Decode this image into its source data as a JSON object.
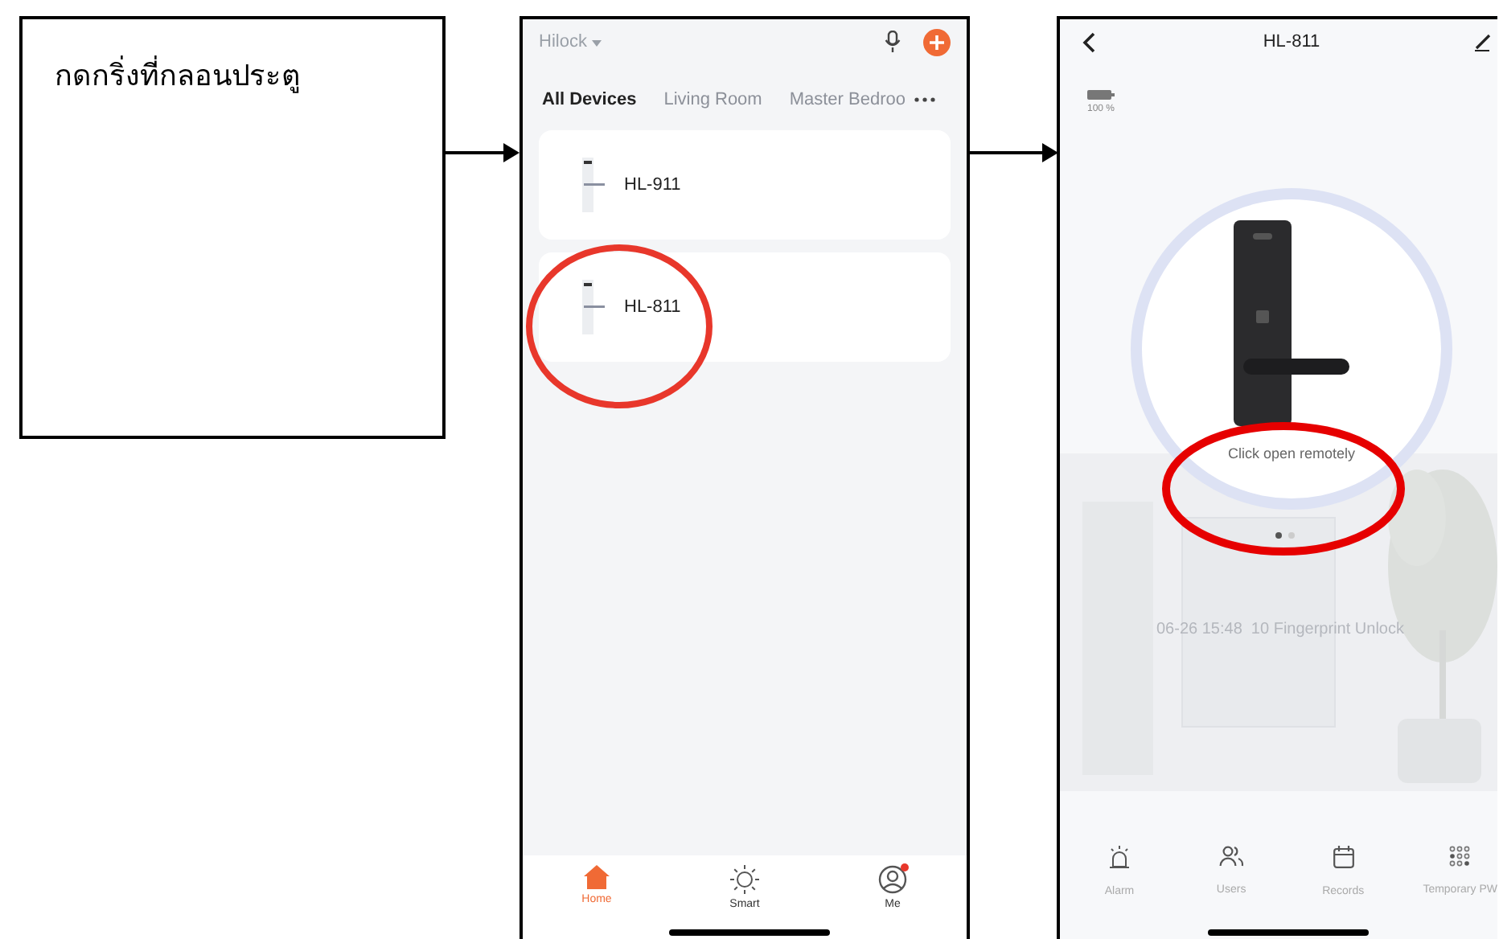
{
  "instruction_box": {
    "text": "กดกริ่งที่กลอนประตู"
  },
  "home_screen": {
    "home_name": "Hilock",
    "tabs": [
      {
        "label": "All Devices",
        "selected": true
      },
      {
        "label": "Living Room",
        "selected": false
      },
      {
        "label": "Master Bedroo",
        "selected": false
      }
    ],
    "devices": [
      {
        "name": "HL-911",
        "highlighted": false
      },
      {
        "name": "HL-811",
        "highlighted": true
      }
    ],
    "nav": [
      {
        "label": "Home",
        "kind": "home",
        "selected": true,
        "badge": false
      },
      {
        "label": "Smart",
        "kind": "smart",
        "selected": false,
        "badge": false
      },
      {
        "label": "Me",
        "kind": "me",
        "selected": false,
        "badge": true
      }
    ]
  },
  "lock_screen": {
    "title": "HL-811",
    "battery": "100 %",
    "action": "Click open remotely",
    "action_highlighted": true,
    "pages": [
      {
        "selected": true
      },
      {
        "selected": false
      }
    ],
    "last_record": "06-26 15:48  10 Fingerprint Unlock",
    "actions": [
      {
        "label": "Alarm",
        "kind": "alarm"
      },
      {
        "label": "Users",
        "kind": "users"
      },
      {
        "label": "Records",
        "kind": "records"
      },
      {
        "label": "Temporary PW",
        "kind": "keypad"
      }
    ]
  }
}
